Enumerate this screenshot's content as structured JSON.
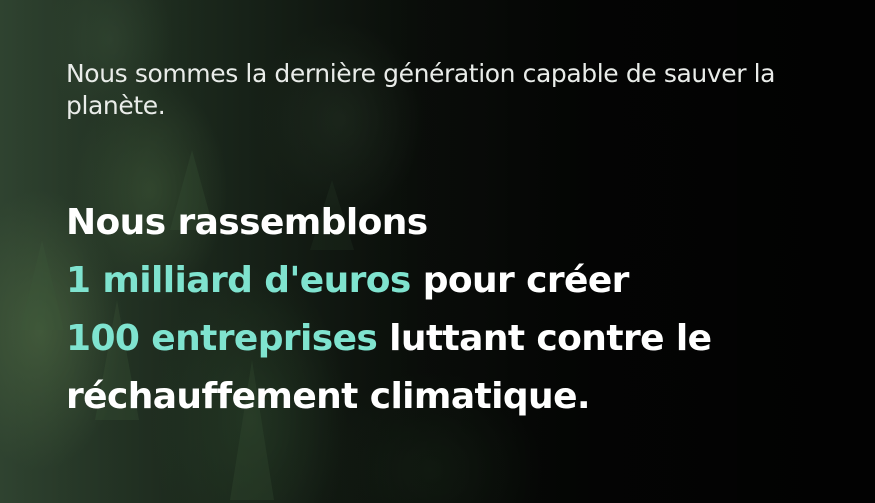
{
  "hero": {
    "intro": "Nous sommes la dernière génération capable de sauver la planète.",
    "headline": {
      "line1": "Nous rassemblons",
      "line2_accent": "1 milliard d'euros",
      "line2_rest": " pour créer",
      "line3_accent": "100 entreprises",
      "line3_rest": " luttant contre le",
      "line4": "réchauffement climatique."
    }
  },
  "colors": {
    "accent": "#7fe3cf",
    "text": "#ffffff",
    "background": "#050505"
  }
}
